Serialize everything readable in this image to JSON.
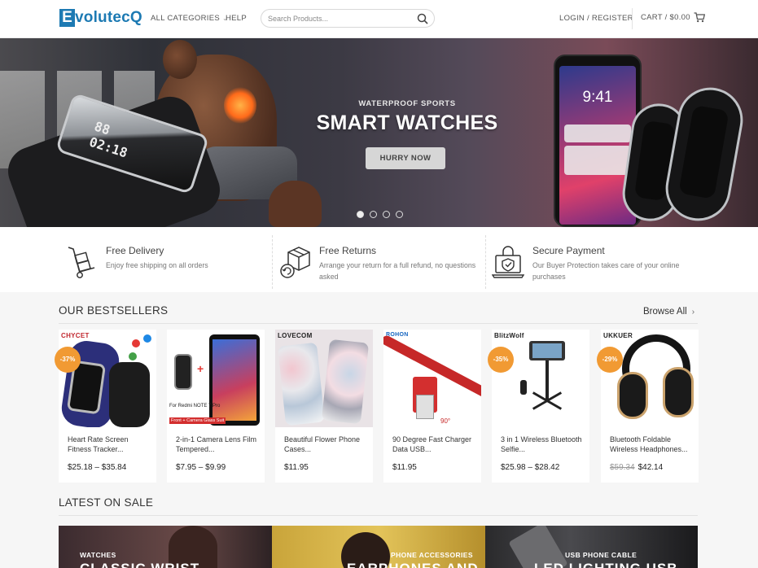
{
  "header": {
    "logo_initial": "E",
    "logo_rest": "volutecQ",
    "nav_categories": "ALL CATEGORIES",
    "nav_help": "HELP",
    "search_placeholder": "Search Products...",
    "login_register": "LOGIN / REGISTER",
    "cart_label": "CART / $0.00"
  },
  "hero": {
    "subtitle": "WATERPROOF SPORTS",
    "title": "SMART WATCHES",
    "button_label": "HURRY NOW",
    "slide_count": 4,
    "active_slide": 1,
    "phone_time": "9:41"
  },
  "features": [
    {
      "title": "Free Delivery",
      "description": "Enjoy free shipping on all orders",
      "icon": "hand-truck-icon"
    },
    {
      "title": "Free Returns",
      "description": "Arrange your return for a full refund, no questions asked",
      "icon": "return-box-icon"
    },
    {
      "title": "Secure Payment",
      "description": "Our Buyer Protection takes care of your online purchases",
      "icon": "secure-laptop-icon"
    }
  ],
  "bestsellers": {
    "title": "OUR BESTSELLERS",
    "browse_label": "Browse All",
    "products": [
      {
        "name": "Heart Rate Screen Fitness Tracker...",
        "price": "$25.18 – $35.84",
        "badge": "-37%",
        "brand": "CHYCET"
      },
      {
        "name": "2-in-1 Camera Lens Film Tempered...",
        "price": "$7.95 – $9.99",
        "badge": "",
        "brand": "",
        "caption": "For Redmi NOTE 7 Pro",
        "caption2": "Front + Camera Glass Suit"
      },
      {
        "name": "Beautiful Flower Phone Cases...",
        "price": "$11.95",
        "badge": "",
        "brand": "LOVECOM"
      },
      {
        "name": "90 Degree Fast Charger Data USB...",
        "price": "$11.95",
        "badge": "",
        "brand": "ROHON",
        "angle": "90°"
      },
      {
        "name": "3 in 1 Wireless Bluetooth Selfie...",
        "price": "$25.98 – $28.42",
        "badge": "-35%",
        "brand": "BlitzWolf"
      },
      {
        "name": "Bluetooth Foldable Wireless Headphones...",
        "old_price": "$59.34",
        "price": "$42.14",
        "badge": "-29%",
        "brand": "UKKUER"
      }
    ]
  },
  "latest_on_sale": {
    "title": "LATEST ON SALE",
    "banners": [
      {
        "category": "WATCHES",
        "headline": "CLASSIC WRIST"
      },
      {
        "category": "PHONE ACCESSORIES",
        "headline": "EARPHONES AND"
      },
      {
        "category": "USB PHONE CABLE",
        "headline": "LED LIGHTING USB"
      }
    ]
  }
}
